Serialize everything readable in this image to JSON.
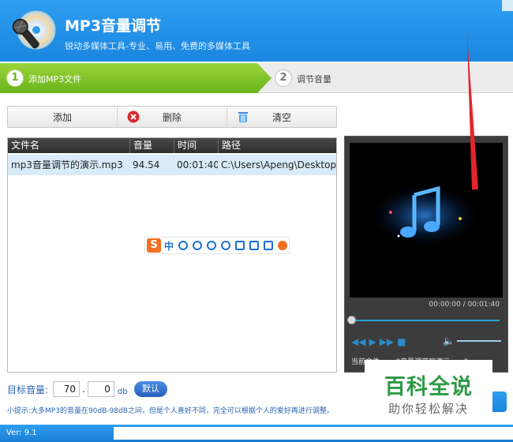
{
  "app": {
    "title": "MP3音量调节",
    "subtitle": "锐动多媒体工具-专业、易用、免费的多媒体工具"
  },
  "steps": [
    {
      "number": "1",
      "label": "添加MP3文件",
      "active": true
    },
    {
      "number": "2",
      "label": "调节音量",
      "active": false
    }
  ],
  "toolbar": {
    "add_label": "添加",
    "delete_label": "删除",
    "clear_label": "清空"
  },
  "file_table": {
    "columns": [
      "文件名",
      "音量",
      "时间",
      "路径"
    ],
    "rows": [
      {
        "name": "mp3音量调节的演示.mp3",
        "volume": "94.54",
        "time": "00:01:40",
        "path": "C:\\Users\\Apeng\\Desktop..."
      }
    ]
  },
  "ime_toolbar": {
    "logo": "S",
    "mode": "中"
  },
  "player": {
    "time_display": "00:00:00 / 00:01:40",
    "current_file": "当前文件: mp3音量调节的演示.mp3",
    "accent": "#27a2d8"
  },
  "target_volume": {
    "label": "目标音量:",
    "integer": "70",
    "separator": ".",
    "decimal": "0",
    "unit": "db",
    "default_label": "默认"
  },
  "tip": "小提示:大多MP3的音量在90dB-98dB之间，但是个人喜好不同，完全可以根据个人的爱好再进行调整。",
  "watermark": {
    "line1": "百科全说",
    "line2": "助你轻松解决"
  },
  "status": {
    "version": "Ver: 9.1"
  },
  "colors": {
    "header_blue": "#1b86e0",
    "step_active_green": "#7cc22a",
    "table_header_dark": "#333333",
    "selected_row": "#d9ebf9",
    "annotation_red": "#e2252c"
  }
}
